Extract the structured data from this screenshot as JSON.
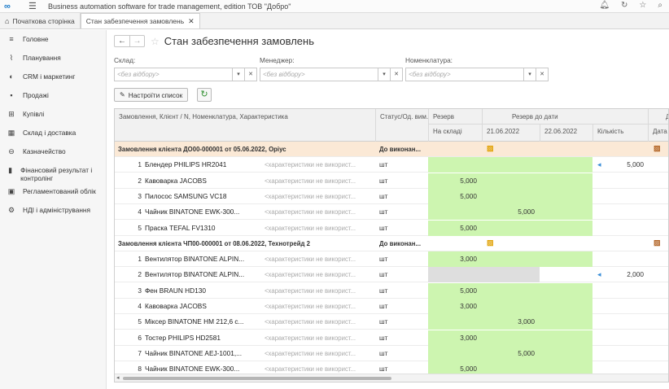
{
  "app": {
    "title": "Business automation software for trade management, edition ТОВ \"Добро\"",
    "logo": "∞"
  },
  "tabs": [
    {
      "label": "Початкова сторінка"
    },
    {
      "label": "Стан забезпечення замовлень"
    }
  ],
  "sidebar": {
    "items": [
      {
        "label": "Головне",
        "icon": "≡"
      },
      {
        "label": "Планування",
        "icon": "⌇"
      },
      {
        "label": "CRM і маркетинг",
        "icon": "◐"
      },
      {
        "label": "Продажі",
        "icon": "▪"
      },
      {
        "label": "Купівлі",
        "icon": "⊞"
      },
      {
        "label": "Склад і доставка",
        "icon": "▦"
      },
      {
        "label": "Казначейство",
        "icon": "⊖"
      },
      {
        "label": "Фінансовий результат і контролінг",
        "icon": "▮"
      },
      {
        "label": "Регламентований облік",
        "icon": "▣"
      },
      {
        "label": "НДІ і адміністрування",
        "icon": "⚙"
      }
    ]
  },
  "page": {
    "title": "Стан забезпечення замовлень"
  },
  "filters": [
    {
      "label": "Склад:",
      "placeholder": "<без відбору>"
    },
    {
      "label": "Менеджер:",
      "placeholder": "<без відбору>"
    },
    {
      "label": "Номенклатура:",
      "placeholder": "<без відбору>"
    }
  ],
  "toolbar": {
    "setup_list": "Настроїти список"
  },
  "table": {
    "headers": {
      "col1": "Замовлення, Клієнт / N, Номенклатура, Характеристика",
      "col2": "Статус/Од. вим.",
      "reserve": "Резерв",
      "reserve_by_date": "Резерв до дати",
      "cut": "Д",
      "on_stock": "На складі",
      "date1": "21.06.2022",
      "date2": "22.06.2022",
      "qty": "Кількість",
      "date_cut": "Дата"
    },
    "rows": [
      {
        "type": "group",
        "name": "Замовлення клієнта ДО00-000001 от 05.06.2022, Оріус",
        "status": "До виконан..."
      },
      {
        "type": "item",
        "n": "1",
        "name": "Блендер PHILIPS HR2041",
        "char": "<характеристики не використ...",
        "unit": "шт",
        "green": [
          1,
          1,
          1,
          0
        ],
        "qty": "5,000"
      },
      {
        "type": "item",
        "n": "2",
        "name": "Кавоварка JACOBS",
        "char": "<характеристики не використ...",
        "unit": "шт",
        "green": [
          1,
          1,
          1,
          0
        ],
        "stock": "5,000"
      },
      {
        "type": "item",
        "n": "3",
        "name": "Пилосос SAMSUNG VC18",
        "char": "<характеристики не використ...",
        "unit": "шт",
        "green": [
          1,
          1,
          1,
          0
        ],
        "stock": "5,000"
      },
      {
        "type": "item",
        "n": "4",
        "name": "Чайник BINATONE  EWK-300...",
        "char": "<характеристики не використ...",
        "unit": "шт",
        "green": [
          1,
          1,
          1,
          0
        ],
        "d1": "5,000"
      },
      {
        "type": "item",
        "n": "5",
        "name": "Праска TEFAL FV1310",
        "char": "<характеристики не використ...",
        "unit": "шт",
        "green": [
          1,
          1,
          1,
          0
        ],
        "stock": "5,000"
      },
      {
        "type": "group2",
        "name": "Замовлення клієнта ЧП00-000001 от 08.06.2022, Технотрейд 2",
        "status": "До виконан..."
      },
      {
        "type": "item",
        "n": "1",
        "name": "Вентилятор BINATONE ALPIN...",
        "char": "<характеристики не використ...",
        "unit": "шт",
        "green": [
          1,
          1,
          1,
          0
        ],
        "stock": "3,000"
      },
      {
        "type": "item",
        "n": "2",
        "name": "Вентилятор BINATONE ALPIN...",
        "char": "<характеристики не використ...",
        "unit": "шт",
        "gray": true,
        "qty": "2,000"
      },
      {
        "type": "item",
        "n": "3",
        "name": "Фен BRAUN HD130",
        "char": "<характеристики не використ...",
        "unit": "шт",
        "green": [
          1,
          1,
          1,
          0
        ],
        "stock": "5,000"
      },
      {
        "type": "item",
        "n": "4",
        "name": "Кавоварка JACOBS",
        "char": "<характеристики не використ...",
        "unit": "шт",
        "green": [
          1,
          1,
          1,
          0
        ],
        "stock": "3,000"
      },
      {
        "type": "item",
        "n": "5",
        "name": "Міксер BINATONE HM 212,6 с...",
        "char": "<характеристики не використ...",
        "unit": "шт",
        "green": [
          1,
          1,
          1,
          0
        ],
        "d1": "3,000"
      },
      {
        "type": "item",
        "n": "6",
        "name": "Тостер PHILIPS HD2581",
        "char": "<характеристики не використ...",
        "unit": "шт",
        "green": [
          1,
          1,
          1,
          0
        ],
        "stock": "3,000"
      },
      {
        "type": "item",
        "n": "7",
        "name": "Чайник BINATONE  AEJ-1001,...",
        "char": "<характеристики не використ...",
        "unit": "шт",
        "green": [
          1,
          1,
          1,
          0
        ],
        "d1": "5,000"
      },
      {
        "type": "item",
        "n": "8",
        "name": "Чайник BINATONE  EWK-300...",
        "char": "<характеристики не використ...",
        "unit": "шт",
        "green": [
          1,
          1,
          1,
          0
        ],
        "stock": "5,000"
      }
    ]
  }
}
